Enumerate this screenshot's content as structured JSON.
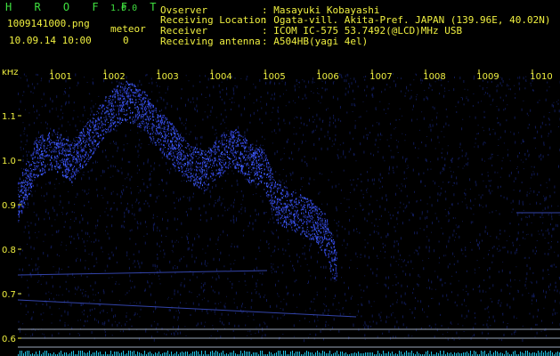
{
  "app": {
    "title": "H R O F F T",
    "version": "1.0.0",
    "filename": "1009141000.png",
    "datetime": "10.09.14 10:00",
    "meteor_label": "meteor",
    "meteor_count": "0"
  },
  "info": {
    "labels": [
      "Ovserver",
      "Receiving Location",
      "Receiver",
      "Receiving antenna"
    ],
    "values": [
      ": Masayuki Kobayashi",
      ": Ogata-vill. Akita-Pref. JAPAN (139.96E, 40.02N)",
      ": ICOM IC-575 53.7492(@LCD)MHz USB",
      ": A504HB(yagi 4el)"
    ]
  },
  "spectrogram": {
    "unit": "kHz",
    "y_ticks": [
      "1.1",
      "1.0",
      "0.9",
      "0.8",
      "0.7",
      "0.6"
    ],
    "x_ticks": [
      "1001",
      "1002",
      "1003",
      "1004",
      "1005",
      "1006",
      "1007",
      "1008",
      "1009",
      "1010"
    ],
    "signal_color": "#4060ff",
    "label_color": "#f0f040"
  }
}
